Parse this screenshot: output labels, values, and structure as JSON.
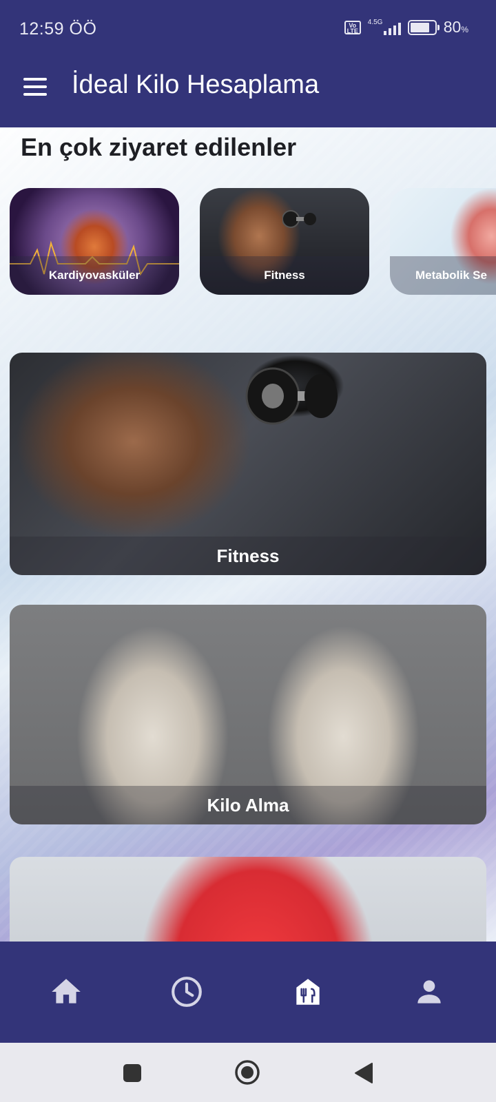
{
  "status_bar": {
    "time": "12:59 ÖÖ",
    "volte": "Vo LTE",
    "network": "4.5G",
    "battery_percent": "80",
    "battery_unit": "%",
    "battery_level": 0.8
  },
  "app_bar": {
    "title": "İdeal Kilo Hesaplama",
    "menu_icon": "hamburger-menu-icon"
  },
  "main": {
    "section_title": "En çok ziyaret edilenler",
    "categories": [
      {
        "label": "Kardiyovasküler"
      },
      {
        "label": "Fitness"
      },
      {
        "label": "Metabolik Se"
      }
    ],
    "cards": [
      {
        "label": "Fitness"
      },
      {
        "label": "Kilo Alma"
      },
      {
        "label": ""
      }
    ]
  },
  "bottom_nav": {
    "items": [
      {
        "icon": "home-icon",
        "active": false
      },
      {
        "icon": "clock-icon",
        "active": false
      },
      {
        "icon": "restaurant-icon",
        "active": true
      },
      {
        "icon": "person-icon",
        "active": false
      }
    ]
  },
  "system_nav": {
    "items": [
      "square-recents-icon",
      "circle-home-icon",
      "triangle-back-icon"
    ]
  },
  "colors": {
    "primary": "#333479",
    "text_dark": "#1e1f24",
    "on_primary": "#ffffff"
  }
}
